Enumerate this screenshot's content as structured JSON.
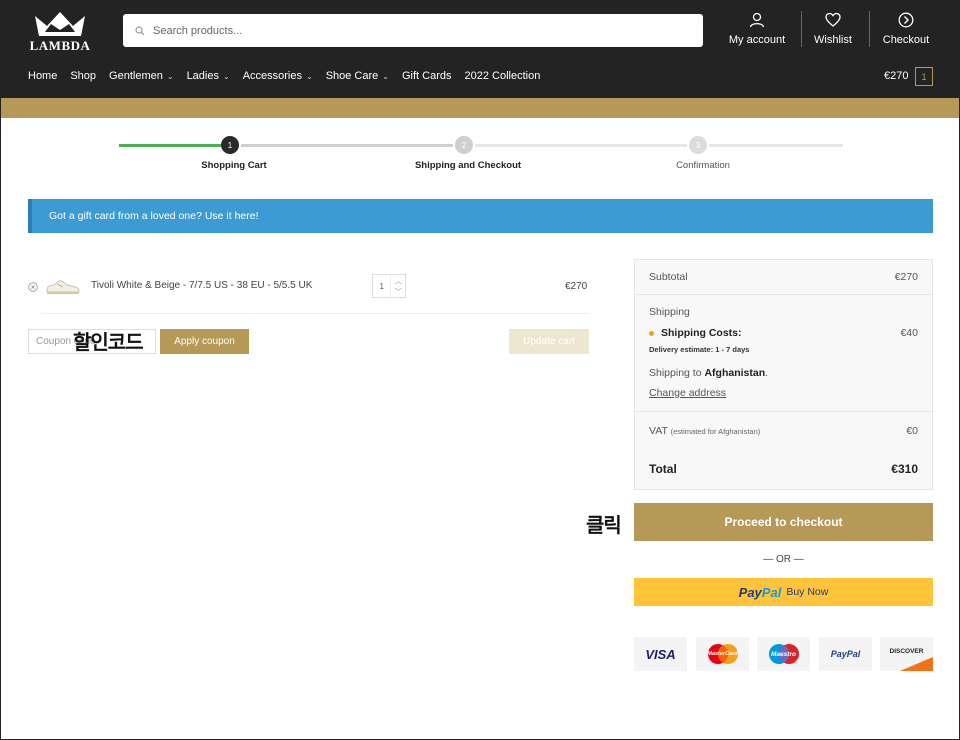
{
  "header": {
    "logo_text": "LAMBDA",
    "search_placeholder": "Search products...",
    "actions": [
      {
        "label": "My account",
        "icon": "user-icon"
      },
      {
        "label": "Wishlist",
        "icon": "heart-icon"
      },
      {
        "label": "Checkout",
        "icon": "arrow-circle-icon"
      }
    ],
    "nav": [
      {
        "label": "Home",
        "dropdown": false
      },
      {
        "label": "Shop",
        "dropdown": false
      },
      {
        "label": "Gentlemen",
        "dropdown": true
      },
      {
        "label": "Ladies",
        "dropdown": true
      },
      {
        "label": "Accessories",
        "dropdown": true
      },
      {
        "label": "Shoe Care",
        "dropdown": true
      },
      {
        "label": "Gift Cards",
        "dropdown": false
      },
      {
        "label": "2022 Collection",
        "dropdown": false
      }
    ],
    "cart_total": "€270",
    "cart_count": "1"
  },
  "progress": {
    "steps": [
      {
        "number": "1",
        "label": "Shopping Cart"
      },
      {
        "number": "2",
        "label": "Shipping and Checkout"
      },
      {
        "number": "3",
        "label": "Confirmation"
      }
    ]
  },
  "notice": "Got a gift card from a loved one? Use it here!",
  "cart": {
    "item": {
      "name": "Tivoli White & Beige - 7/7.5 US - 38 EU - 5/5.5 UK",
      "quantity": "1",
      "price": "€270"
    },
    "coupon_placeholder": "Coupon code",
    "apply_label": "Apply coupon",
    "update_label": "Update cart"
  },
  "totals": {
    "subtotal_label": "Subtotal",
    "subtotal_value": "€270",
    "shipping_label": "Shipping",
    "shipping_costs_label": "Shipping Costs:",
    "shipping_costs_value": "€40",
    "delivery_estimate": "Delivery estimate: 1 - 7 days",
    "shipping_to_prefix": "Shipping to ",
    "shipping_to_country": "Afghanistan",
    "shipping_to_suffix": ".",
    "change_address": "Change address",
    "vat_label": "VAT",
    "vat_note": "(estimated for Afghanistan)",
    "vat_value": "€0",
    "total_label": "Total",
    "total_value": "€310"
  },
  "checkout_label": "Proceed to checkout",
  "or_label": "— OR —",
  "paypal": {
    "logo_pay": "Pay",
    "logo_pal": "Pal",
    "text": "Buy Now"
  },
  "cards": [
    "VISA",
    "MasterCard",
    "Maestro",
    "PayPal",
    "DISCOVER"
  ],
  "annotations": {
    "coupon": "할인코드",
    "click": "클릭"
  },
  "colors": {
    "header_bg": "#232323",
    "gold": "#b59a57",
    "notice_blue": "#3d9bd3",
    "progress_green": "#4caf50",
    "paypal_yellow": "#ffc439"
  }
}
